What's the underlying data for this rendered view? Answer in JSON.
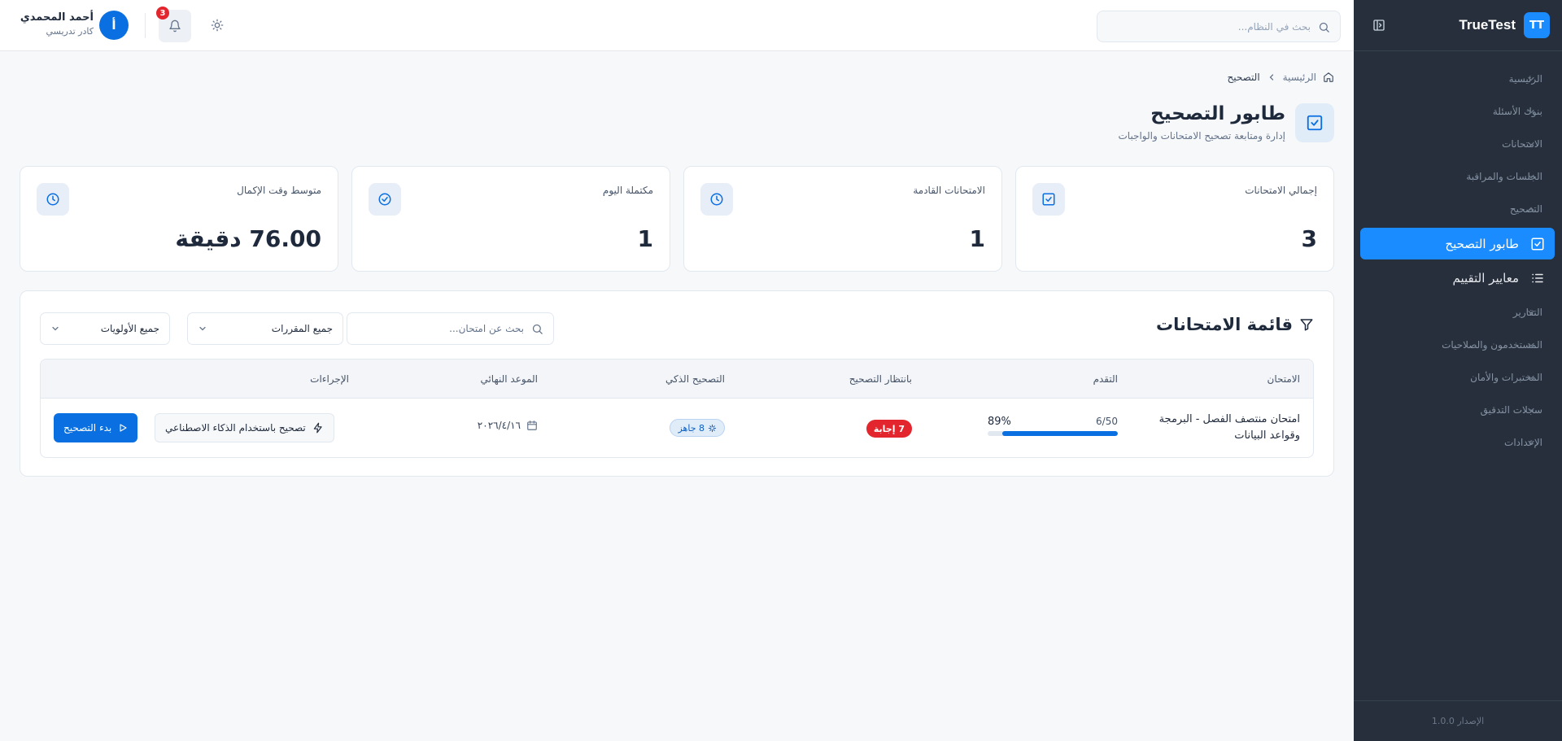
{
  "app": {
    "logo_initials": "TT",
    "name": "TrueTest",
    "version": "الإصدار 1.0.0"
  },
  "sidebar": {
    "items": [
      {
        "label": "الرئيسية",
        "expanded": false
      },
      {
        "label": "بنوك الأسئلة",
        "expanded": false
      },
      {
        "label": "الامتحانات",
        "expanded": false
      },
      {
        "label": "الجلسات والمراقبة",
        "expanded": false
      },
      {
        "label": "التصحيح",
        "expanded": true
      },
      {
        "label": "التقارير",
        "expanded": false
      },
      {
        "label": "المستخدمون والصلاحيات",
        "expanded": false
      },
      {
        "label": "المختبرات والأمان",
        "expanded": false
      },
      {
        "label": "سجلات التدقيق",
        "expanded": false
      },
      {
        "label": "الإعدادات",
        "expanded": false
      }
    ],
    "sub_items": [
      {
        "label": "طابور التصحيح",
        "active": true,
        "icon": "check-square-icon"
      },
      {
        "label": "معايير التقييم",
        "active": false,
        "icon": "list-icon"
      }
    ]
  },
  "topbar": {
    "search_placeholder": "بحث في النظام...",
    "notifications_count": "3",
    "user": {
      "initial": "أ",
      "name": "أحمد المحمدي",
      "role": "كادر تدريسي"
    }
  },
  "breadcrumb": {
    "home": "الرئيسية",
    "current": "التصحيح"
  },
  "page": {
    "title": "طابور التصحيح",
    "subtitle": "إدارة ومتابعة تصحيح الامتحانات والواجبات"
  },
  "stats": [
    {
      "label": "إجمالي الامتحانات",
      "value": "3",
      "icon": "check-square-icon"
    },
    {
      "label": "الامتحانات القادمة",
      "value": "1",
      "icon": "clock-icon"
    },
    {
      "label": "مكتملة اليوم",
      "value": "1",
      "icon": "check-circle-icon"
    },
    {
      "label": "متوسط وقت الإكمال",
      "value": "76.00 دقيقة",
      "icon": "clock-icon"
    }
  ],
  "exams_list": {
    "title": "قائمة الامتحانات",
    "search_placeholder": "بحث عن امتحان...",
    "course_filter": "جميع المقررات",
    "priority_filter": "جميع الأولويات",
    "columns": [
      "الامتحان",
      "التقدم",
      "بانتظار التصحيح",
      "التصحيح الذكي",
      "الموعد النهائي",
      "الإجراءات"
    ],
    "rows": [
      {
        "name": "امتحان منتصف الفصل - البرمجة وقواعد البيانات",
        "progress_text": "6/50",
        "progress_percent": "89%",
        "progress_fraction": 0.89,
        "pending": "7 إجابة",
        "ai_ready": "8 جاهز",
        "deadline": "٢٠٢٦/٤/١٦",
        "ai_grade_label": "تصحيح باستخدام الذكاء الاصطناعي",
        "start_label": "بدء التصحيح"
      }
    ]
  },
  "colors": {
    "primary": "#0a6fe0",
    "sidebar_bg": "#262f3b",
    "active_item": "#1a8cff",
    "danger": "#e3262e"
  }
}
